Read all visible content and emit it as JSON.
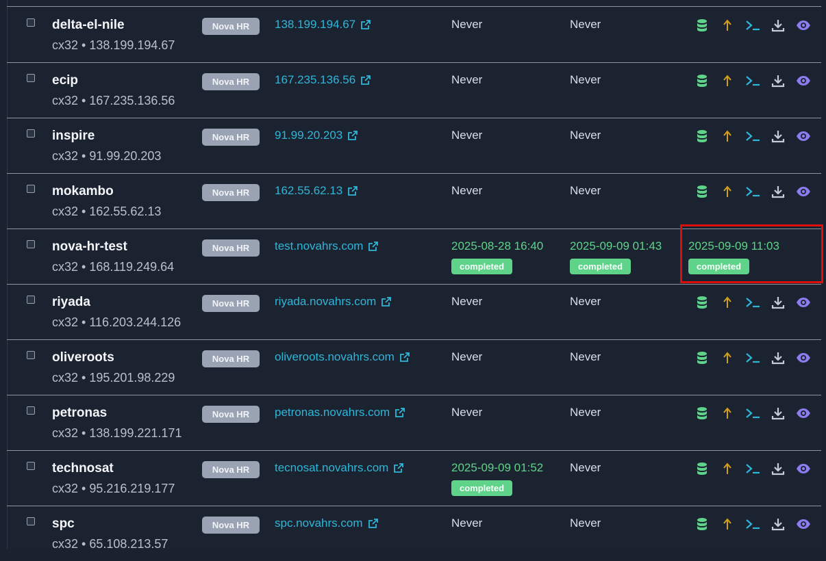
{
  "colors": {
    "background": "#1b2331",
    "accent_link": "#2fb6d9",
    "status_green": "#5fd38a",
    "tag_gray": "#9aa3b3",
    "highlight_red": "#e00d0d"
  },
  "icons": [
    "database-icon",
    "arrow-up-icon",
    "terminal-icon",
    "download-icon",
    "eye-icon"
  ],
  "rows": [
    {
      "name": "delta-el-nile",
      "sub": "cx32 • 138.199.194.67",
      "tag": "Nova HR",
      "link": "138.199.194.67",
      "col1": "Never",
      "col2": "Never"
    },
    {
      "name": "ecip",
      "sub": "cx32 • 167.235.136.56",
      "tag": "Nova HR",
      "link": "167.235.136.56",
      "col1": "Never",
      "col2": "Never"
    },
    {
      "name": "inspire",
      "sub": "cx32 • 91.99.20.203",
      "tag": "Nova HR",
      "link": "91.99.20.203",
      "col1": "Never",
      "col2": "Never"
    },
    {
      "name": "mokambo",
      "sub": "cx32 • 162.55.62.13",
      "tag": "Nova HR",
      "link": "162.55.62.13",
      "col1": "Never",
      "col2": "Never"
    },
    {
      "name": "nova-hr-test",
      "sub": "cx32 • 168.119.249.64",
      "tag": "Nova HR",
      "link": "test.novahrs.com",
      "col1": "2025-08-28 16:40",
      "col1_badge": "completed",
      "col2": "2025-09-09 01:43",
      "col2_badge": "completed",
      "col3": "2025-09-09 11:03",
      "col3_badge": "completed"
    },
    {
      "name": "riyada",
      "sub": "cx32 • 116.203.244.126",
      "tag": "Nova HR",
      "link": "riyada.novahrs.com",
      "col1": "Never",
      "col2": "Never"
    },
    {
      "name": "oliveroots",
      "sub": "cx32 • 195.201.98.229",
      "tag": "Nova HR",
      "link": "oliveroots.novahrs.com",
      "col1": "Never",
      "col2": "Never"
    },
    {
      "name": "petronas",
      "sub": "cx32 • 138.199.221.171",
      "tag": "Nova HR",
      "link": "petronas.novahrs.com",
      "col1": "Never",
      "col2": "Never"
    },
    {
      "name": "technosat",
      "sub": "cx32 • 95.216.219.177",
      "tag": "Nova HR",
      "link": "tecnosat.novahrs.com",
      "col1": "2025-09-09 01:52",
      "col1_badge": "completed",
      "col2": "Never"
    },
    {
      "name": "spc",
      "sub": "cx32 • 65.108.213.57",
      "tag": "Nova HR",
      "link": "spc.novahrs.com",
      "col1": "Never",
      "col2": "Never"
    }
  ]
}
